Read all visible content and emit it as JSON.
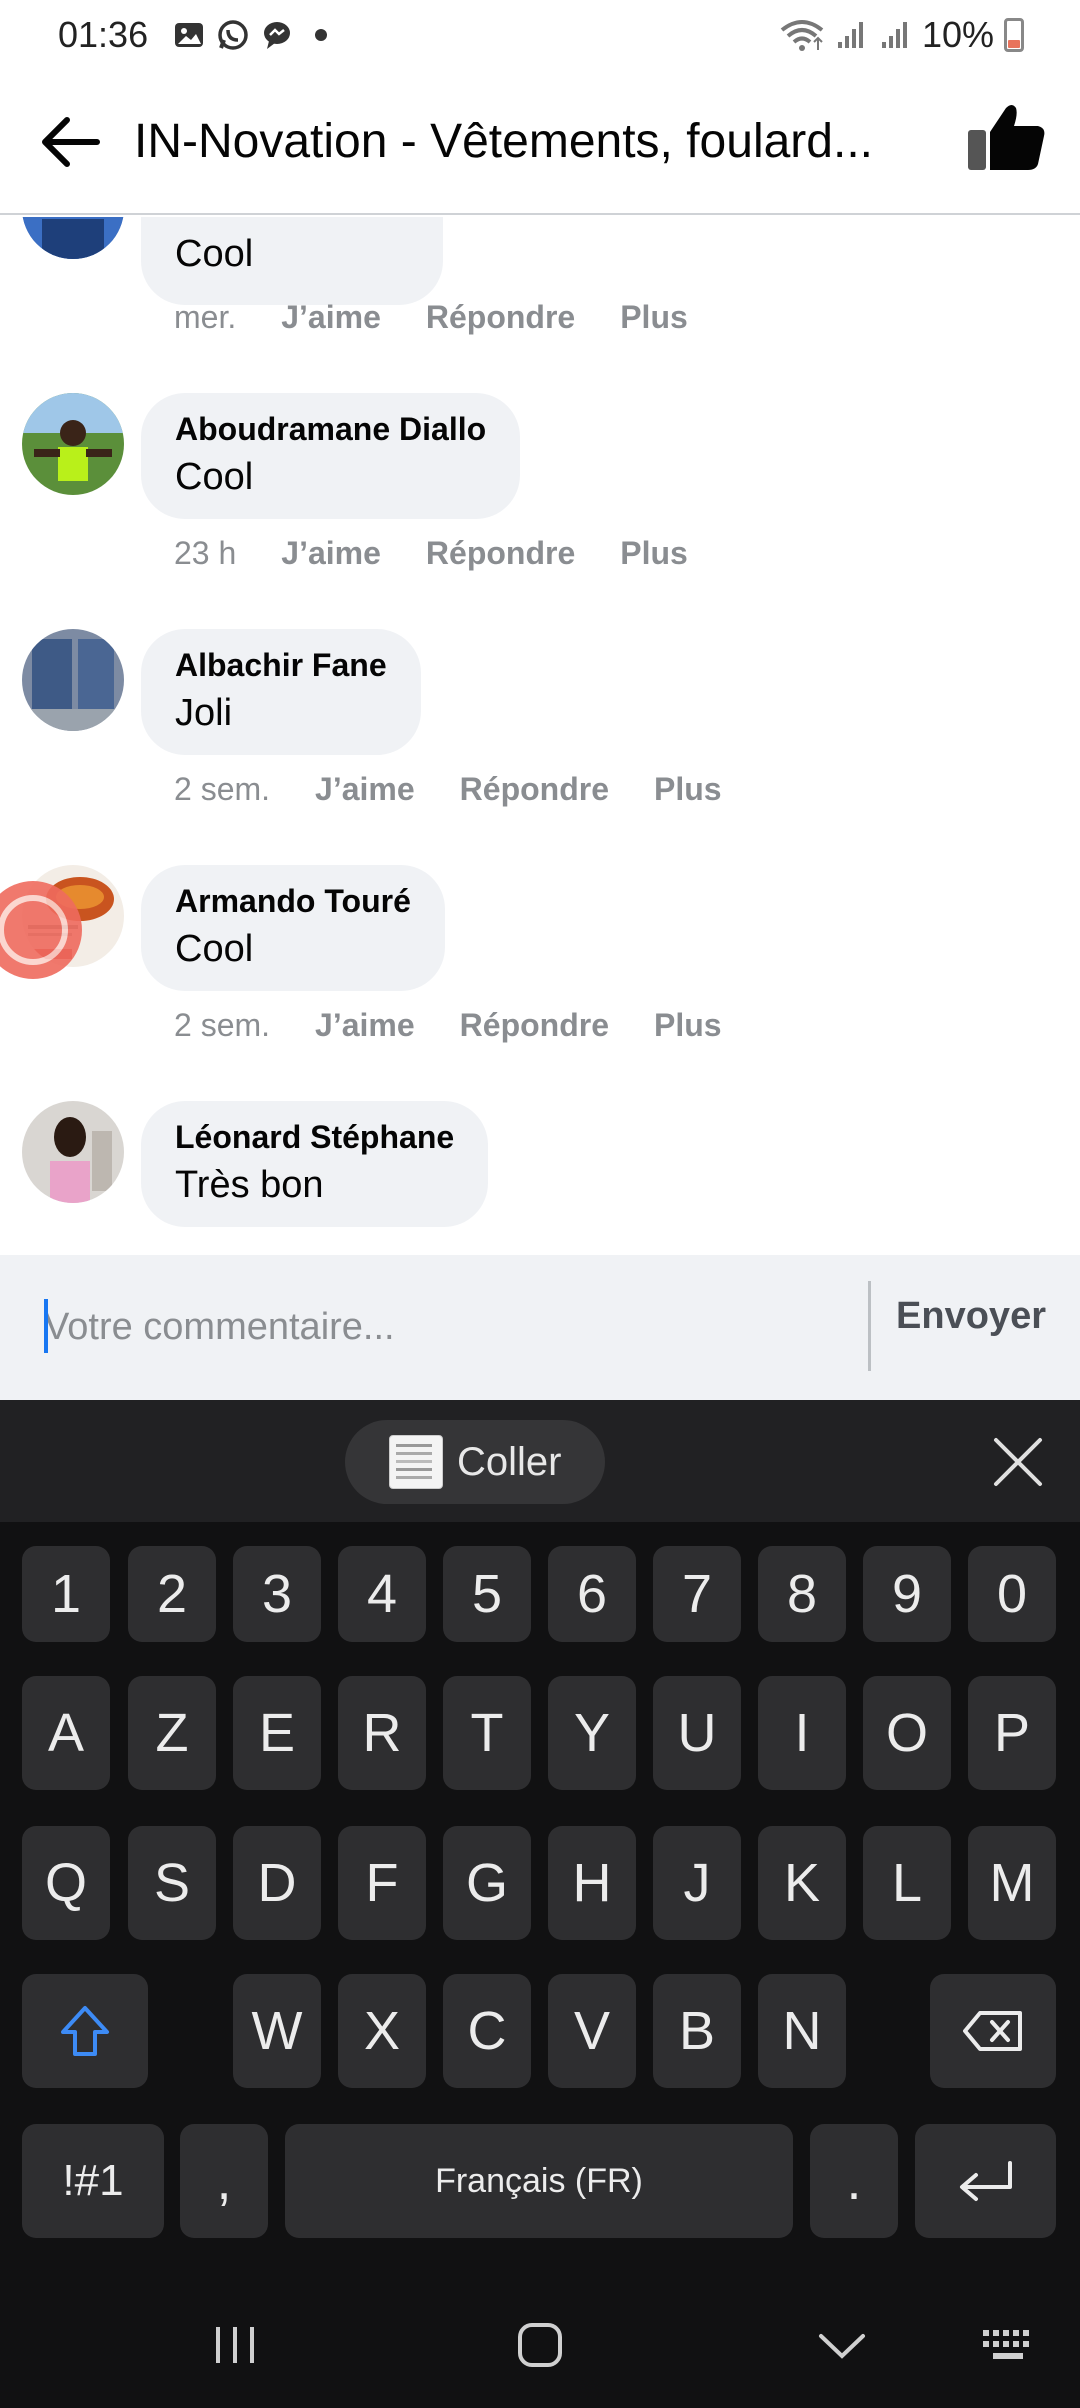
{
  "status_bar": {
    "time": "01:36",
    "battery_percent": "10%",
    "icons": [
      "gallery-icon",
      "whatsapp-icon",
      "messenger-icon",
      "dot-icon",
      "wifi-icon",
      "signal-icon",
      "signal-icon",
      "battery-icon"
    ]
  },
  "header": {
    "title": "IN-Novation - Vêtements, foulard...",
    "like_icon": "thumbs-up-icon"
  },
  "comments": [
    {
      "author": "",
      "text": "Cool",
      "time": "mer.",
      "like": "J’aime",
      "reply": "Répondre",
      "more": "Plus"
    },
    {
      "author": "Aboudramane Diallo",
      "text": "Cool",
      "time": "23 h",
      "like": "J’aime",
      "reply": "Répondre",
      "more": "Plus"
    },
    {
      "author": "Albachir Fane",
      "text": "Joli",
      "time": "2 sem.",
      "like": "J’aime",
      "reply": "Répondre",
      "more": "Plus"
    },
    {
      "author": "Armando Touré",
      "text": "Cool",
      "time": "2 sem.",
      "like": "J’aime",
      "reply": "Répondre",
      "more": "Plus"
    },
    {
      "author": "Léonard Stéphane",
      "text": "Très bon",
      "time": "",
      "like": "",
      "reply": "",
      "more": ""
    }
  ],
  "composer": {
    "placeholder": "Votre commentaire...",
    "send_label": "Envoyer"
  },
  "keyboard": {
    "paste_label": "Coller",
    "row_numbers": [
      "1",
      "2",
      "3",
      "4",
      "5",
      "6",
      "7",
      "8",
      "9",
      "0"
    ],
    "row1": [
      "A",
      "Z",
      "E",
      "R",
      "T",
      "Y",
      "U",
      "I",
      "O",
      "P"
    ],
    "row2": [
      "Q",
      "S",
      "D",
      "F",
      "G",
      "H",
      "J",
      "K",
      "L",
      "M"
    ],
    "row3": [
      "W",
      "X",
      "C",
      "V",
      "B",
      "N"
    ],
    "symbols_key": "!#1",
    "comma_key": ",",
    "space_label": "Français (FR)",
    "period_key": "."
  }
}
